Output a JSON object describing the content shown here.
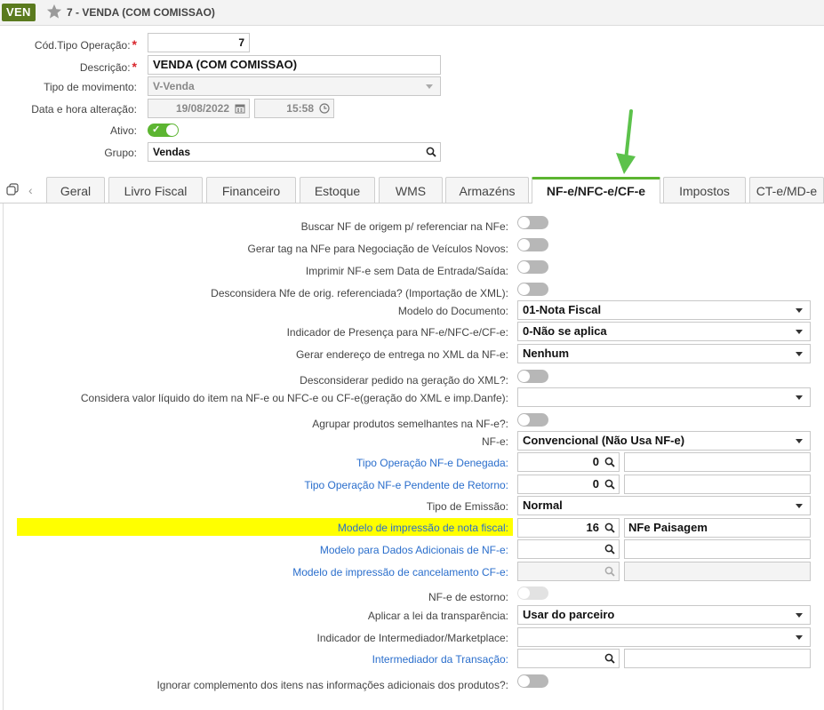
{
  "titlebar": {
    "badge": "VEN",
    "title": "7 - VENDA (COM COMISSAO)"
  },
  "header": {
    "cod_label": "Cód.Tipo Operação:",
    "cod_value": "7",
    "desc_label": "Descrição:",
    "desc_value": "VENDA  (COM COMISSAO)",
    "tipo_label": "Tipo de movimento:",
    "tipo_value": "V-Venda",
    "data_label": "Data e hora alteração:",
    "date_value": "19/08/2022",
    "time_value": "15:58",
    "ativo_label": "Ativo:",
    "ativo_on": true,
    "grupo_label": "Grupo:",
    "grupo_value": "Vendas"
  },
  "tabs": [
    {
      "label": "Geral",
      "active": false
    },
    {
      "label": "Livro Fiscal",
      "active": false
    },
    {
      "label": "Financeiro",
      "active": false
    },
    {
      "label": "Estoque",
      "active": false
    },
    {
      "label": "WMS",
      "active": false
    },
    {
      "label": "Armazéns",
      "active": false
    },
    {
      "label": "NF-e/NFC-e/CF-e",
      "active": true
    },
    {
      "label": "Impostos",
      "active": false
    },
    {
      "label": "CT-e/MD-e",
      "active": false
    }
  ],
  "fields": {
    "buscar_nf": {
      "label": "Buscar NF de origem p/ referenciar na NFe:",
      "on": false
    },
    "gerar_tag": {
      "label": "Gerar tag na NFe para Negociação de Veículos Novos:",
      "on": false
    },
    "imprimir_nfe": {
      "label": "Imprimir NF-e sem Data de Entrada/Saída:",
      "on": false
    },
    "desconsidera_nfe": {
      "label": "Desconsidera Nfe de orig. referenciada? (Importação de XML):",
      "on": false
    },
    "modelo_doc": {
      "label": "Modelo do Documento:",
      "value": "01-Nota Fiscal"
    },
    "indicador_presenca": {
      "label": "Indicador de Presença para NF-e/NFC-e/CF-e:",
      "value": "0-Não se aplica"
    },
    "gerar_endereco": {
      "label": "Gerar endereço de entrega no XML da NF-e:",
      "value": "Nenhum"
    },
    "desconsiderar_pedido": {
      "label": "Desconsiderar pedido na geração do XML?:",
      "on": false
    },
    "considera_valor": {
      "label": "Considera valor líquido do item na NF-e ou NFC-e ou CF-e(geração do XML e imp.Danfe):",
      "value": ""
    },
    "agrupar": {
      "label": "Agrupar produtos semelhantes na NF-e?:",
      "on": false
    },
    "nfe": {
      "label": "NF-e:",
      "value": "Convencional (Não Usa NF-e)"
    },
    "tipo_op_denegada": {
      "label": "Tipo Operação NF-e Denegada:",
      "value": "0",
      "desc": ""
    },
    "tipo_op_pendente": {
      "label": "Tipo Operação NF-e Pendente de Retorno:",
      "value": "0",
      "desc": ""
    },
    "tipo_emissao": {
      "label": "Tipo de Emissão:",
      "value": "Normal"
    },
    "modelo_impressao": {
      "label": "Modelo de impressão de nota fiscal:",
      "value": "16",
      "desc": "NFe Paisagem"
    },
    "modelo_dados_adicionais": {
      "label": "Modelo para Dados Adicionais de NF-e:",
      "value": "",
      "desc": ""
    },
    "modelo_cancelamento": {
      "label": "Modelo de impressão de cancelamento CF-e:",
      "value": "",
      "desc": ""
    },
    "nfe_estorno": {
      "label": "NF-e de estorno:",
      "on": false
    },
    "aplicar_lei": {
      "label": "Aplicar a lei da transparência:",
      "value": "Usar do parceiro"
    },
    "indicador_intermediador": {
      "label": "Indicador de Intermediador/Marketplace:",
      "value": ""
    },
    "intermediador": {
      "label": "Intermediador da Transação:",
      "value": "",
      "desc": ""
    },
    "ignorar_complemento": {
      "label": "Ignorar complemento dos itens nas informações adicionais dos produtos?:",
      "on": false
    }
  },
  "colors": {
    "accent": "#5cb531",
    "link": "#2a6ecc",
    "highlight": "#ffff00",
    "badge": "#5a7a1e"
  }
}
